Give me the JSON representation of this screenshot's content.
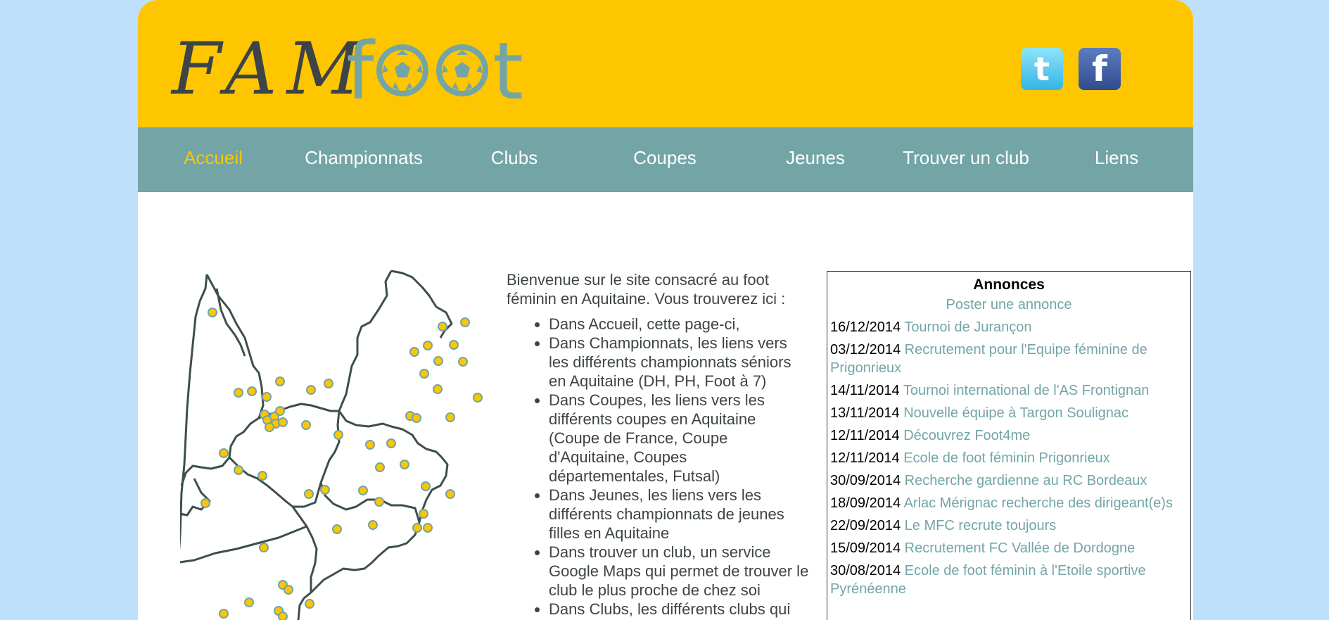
{
  "logo": {
    "part1": "FAM",
    "part2": "foot"
  },
  "social": {
    "twitter_glyph": "t",
    "facebook_glyph": "f"
  },
  "nav": {
    "items": [
      {
        "label": "Accueil"
      },
      {
        "label": "Championnats"
      },
      {
        "label": "Clubs"
      },
      {
        "label": "Coupes"
      },
      {
        "label": "Jeunes"
      },
      {
        "label": "Trouver un club"
      },
      {
        "label": "Liens"
      }
    ]
  },
  "intro": {
    "paragraph": "Bienvenue sur le site consacré au foot féminin en Aquitaine. Vous trouverez ici :",
    "bullets": [
      "Dans Accueil, cette page-ci,",
      "Dans Championnats, les liens vers les différents championnats séniors en Aquitaine (DH, PH, Foot à 7)",
      "Dans Coupes, les liens vers les différents coupes en Aquitaine (Coupe de France, Coupe d'Aquitaine, Coupes départementales, Futsal)",
      "Dans Jeunes, les liens vers les différents championnats de jeunes filles en Aquitaine",
      "Dans trouver un club, un service Google Maps qui permet de trouver le club le plus proche de chez soi",
      "Dans Clubs, les différents clubs qui"
    ]
  },
  "ads": {
    "title": "Annonces",
    "post_label": "Poster une annonce",
    "items": [
      {
        "date": "16/12/2014",
        "title": "Tournoi de Jurançon"
      },
      {
        "date": "03/12/2014",
        "title": "Recrutement pour l'Equipe féminine de Prigonrieux"
      },
      {
        "date": "14/11/2014",
        "title": "Tournoi international de l'AS Frontignan"
      },
      {
        "date": "13/11/2014",
        "title": "Nouvelle équipe à Targon Soulignac"
      },
      {
        "date": "12/11/2014",
        "title": "Découvrez Foot4me"
      },
      {
        "date": "12/11/2014",
        "title": "Ecole de foot féminin Prigonrieux"
      },
      {
        "date": "30/09/2014",
        "title": "Recherche gardienne au RC Bordeaux"
      },
      {
        "date": "18/09/2014",
        "title": "Arlac Mérignac recherche des dirigeant(e)s"
      },
      {
        "date": "22/09/2014",
        "title": "Le MFC recrute toujours"
      },
      {
        "date": "15/09/2014",
        "title": "Recrutement FC Vallée de Dordogne"
      },
      {
        "date": "30/08/2014",
        "title": "Ecole de foot féminin à l'Etoile sportive Pyrénéenne"
      }
    ]
  },
  "colors": {
    "header": "#fec600",
    "nav": "#73a5a7",
    "link": "#73a5a7",
    "background": "#bfe0fb"
  }
}
